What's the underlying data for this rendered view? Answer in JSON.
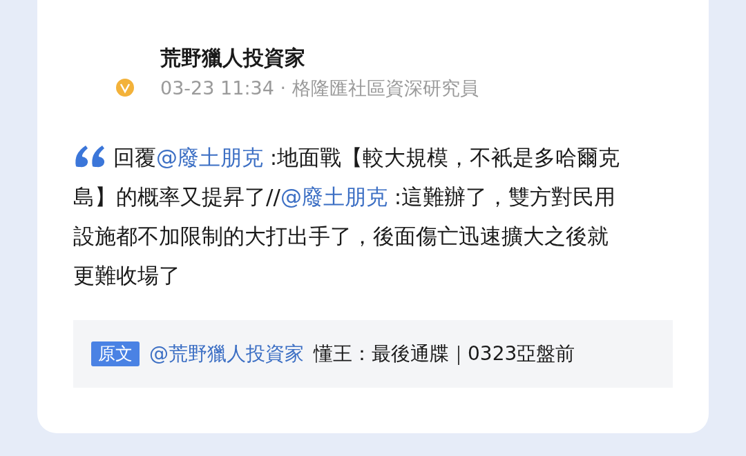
{
  "post": {
    "author": "荒野獵人投資家",
    "meta": "03-23 11:34 · 格隆匯社區資深研究員",
    "body": [
      {
        "kind": "text",
        "text": "回覆"
      },
      {
        "kind": "mention",
        "text": "@廢土朋克"
      },
      {
        "kind": "text",
        "text": " :地面戰【較大規模，不衹是多哈爾克島】的概率又提昇了//"
      },
      {
        "kind": "mention",
        "text": "@廢土朋克"
      },
      {
        "kind": "text",
        "text": " :這難辦了，雙方對民用設施都不加限制的大打出手了，後面傷亡迅速擴大之後就更難收場了"
      }
    ]
  },
  "original": {
    "badge": "原文",
    "author": "@荒野獵人投資家",
    "title": "懂王：最後通牒｜0323亞盤前"
  }
}
